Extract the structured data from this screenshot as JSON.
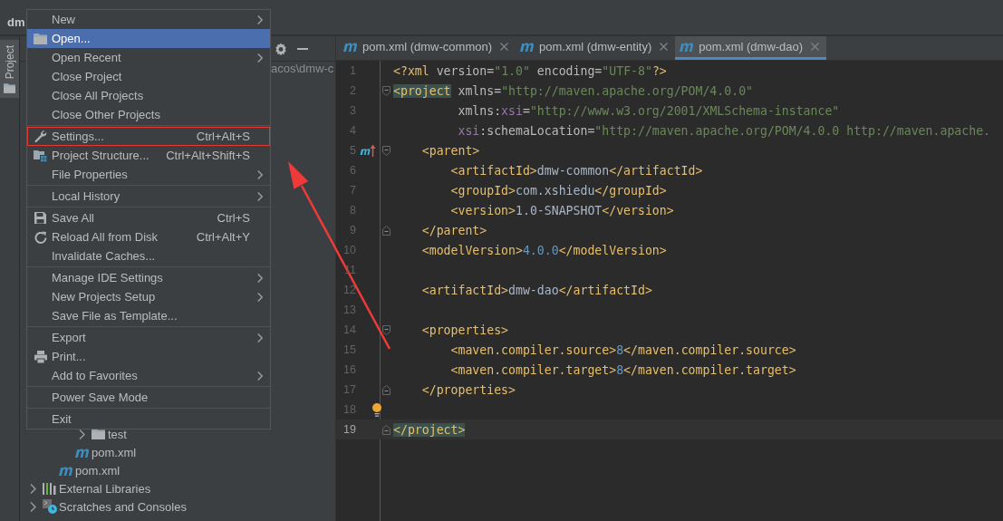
{
  "navbar": {
    "project_label": "dm"
  },
  "tool_window_strip": [
    {
      "label": "Project",
      "selected": true
    }
  ],
  "project_panel": {
    "path_fragment": "acos\\dmw-c",
    "tree": [
      {
        "children": [
          {
            "children": [
              {
                "children": [
                  {
                    "label": "test",
                    "kind": "folder",
                    "expanded": false
                  }
                ]
              },
              {
                "label": "pom.xml",
                "kind": "maven"
              }
            ]
          },
          {
            "label": "pom.xml",
            "kind": "maven"
          }
        ]
      },
      {
        "label": "External Libraries",
        "kind": "libraries",
        "expanded": false
      },
      {
        "label": "Scratches and Consoles",
        "kind": "scratches",
        "expanded": false
      }
    ]
  },
  "file_menu": {
    "groups": [
      [
        {
          "label": "New",
          "submenu": true,
          "selected": false
        },
        {
          "label": "Open...",
          "kind": "folder",
          "submenu": false,
          "selected": true
        },
        {
          "label": "Open Recent",
          "submenu": true,
          "selected": false
        },
        {
          "label": "Close Project",
          "submenu": false,
          "selected": false
        },
        {
          "label": "Close All Projects",
          "submenu": false,
          "selected": false
        },
        {
          "label": "Close Other Projects",
          "submenu": false,
          "selected": false
        }
      ],
      [
        {
          "label": "Settings...",
          "kind": "wrench",
          "shortcut": "Ctrl+Alt+S",
          "submenu": false,
          "selected": false,
          "boxed": true
        },
        {
          "label": "Project Structure...",
          "kind": "structure",
          "shortcut": "Ctrl+Alt+Shift+S",
          "submenu": false,
          "selected": false
        },
        {
          "label": "File Properties",
          "submenu": true,
          "selected": false
        }
      ],
      [
        {
          "label": "Local History",
          "submenu": true,
          "selected": false
        }
      ],
      [
        {
          "label": "Save All",
          "kind": "save",
          "shortcut": "Ctrl+S",
          "submenu": false,
          "selected": false
        },
        {
          "label": "Reload All from Disk",
          "kind": "reload",
          "shortcut": "Ctrl+Alt+Y",
          "submenu": false,
          "selected": false
        },
        {
          "label": "Invalidate Caches...",
          "submenu": false,
          "selected": false
        }
      ],
      [
        {
          "label": "Manage IDE Settings",
          "submenu": true,
          "selected": false
        },
        {
          "label": "New Projects Setup",
          "submenu": true,
          "selected": false
        },
        {
          "label": "Save File as Template...",
          "submenu": false,
          "selected": false
        }
      ],
      [
        {
          "label": "Export",
          "submenu": true,
          "selected": false
        },
        {
          "label": "Print...",
          "kind": "printer",
          "submenu": false,
          "selected": false
        },
        {
          "label": "Add to Favorites",
          "submenu": true,
          "selected": false
        }
      ],
      [
        {
          "label": "Power Save Mode",
          "submenu": false,
          "selected": false
        }
      ],
      [
        {
          "label": "Exit",
          "submenu": false,
          "selected": false
        }
      ]
    ]
  },
  "editor_tabs": [
    {
      "label": "pom.xml (dmw-common)",
      "selected": false
    },
    {
      "label": "pom.xml (dmw-entity)",
      "selected": false
    },
    {
      "label": "pom.xml (dmw-dao)",
      "selected": true
    }
  ],
  "code_lines": [
    {
      "number": "1",
      "current": false,
      "tokens": [
        {
          "kind": "tag",
          "text": "<?xml"
        },
        {
          "kind": "attr",
          "text": " version="
        },
        {
          "kind": "value",
          "text": "\"1.0\""
        },
        {
          "kind": "attr",
          "text": " encoding="
        },
        {
          "kind": "value",
          "text": "\"UTF-8\""
        },
        {
          "kind": "tag",
          "text": "?>"
        }
      ]
    },
    {
      "number": "2",
      "current": false,
      "fold_start": true,
      "tokens": [
        {
          "kind": "tag",
          "text": "<project",
          "matched": true
        },
        {
          "kind": "attr",
          "text": " xmlns="
        },
        {
          "kind": "value",
          "text": "\"http://maven.apache.org/POM/4.0.0\""
        }
      ]
    },
    {
      "number": "3",
      "current": false,
      "tokens": [
        {
          "kind": "attr",
          "text": "         xmlns:"
        },
        {
          "kind": "ns",
          "text": "xsi"
        },
        {
          "kind": "attr",
          "text": "="
        },
        {
          "kind": "value",
          "text": "\"http://www.w3.org/2001/XMLSchema-instance\""
        }
      ]
    },
    {
      "number": "4",
      "current": false,
      "tokens": [
        {
          "kind": "ns",
          "text": "         xsi"
        },
        {
          "kind": "attr",
          "text": ":schemaLocation="
        },
        {
          "kind": "value",
          "text": "\"http://maven.apache.org/POM/4.0.0 http://maven.apache."
        }
      ]
    },
    {
      "number": "5",
      "current": false,
      "overrides_parent": true,
      "fold_start": true,
      "tokens": [
        {
          "kind": "tag",
          "text": "    <parent>"
        }
      ]
    },
    {
      "number": "6",
      "current": false,
      "tokens": [
        {
          "kind": "tag",
          "text": "        <artifactId>"
        },
        {
          "kind": "text",
          "text": "dmw-common"
        },
        {
          "kind": "tag",
          "text": "</artifactId>"
        }
      ]
    },
    {
      "number": "7",
      "current": false,
      "tokens": [
        {
          "kind": "tag",
          "text": "        <groupId>"
        },
        {
          "kind": "text",
          "text": "com.xshiedu"
        },
        {
          "kind": "tag",
          "text": "</groupId>"
        }
      ]
    },
    {
      "number": "8",
      "current": false,
      "tokens": [
        {
          "kind": "tag",
          "text": "        <version>"
        },
        {
          "kind": "text",
          "text": "1.0-SNAPSHOT"
        },
        {
          "kind": "tag",
          "text": "</version>"
        }
      ]
    },
    {
      "number": "9",
      "current": false,
      "fold_end": true,
      "tokens": [
        {
          "kind": "tag",
          "text": "    </parent>"
        }
      ]
    },
    {
      "number": "10",
      "current": false,
      "tokens": [
        {
          "kind": "tag",
          "text": "    <modelVersion>"
        },
        {
          "kind": "number",
          "text": "4.0.0"
        },
        {
          "kind": "tag",
          "text": "</modelVersion>"
        }
      ]
    },
    {
      "number": "11",
      "current": false
    },
    {
      "number": "12",
      "current": false,
      "tokens": [
        {
          "kind": "tag",
          "text": "    <artifactId>"
        },
        {
          "kind": "text",
          "text": "dmw-dao"
        },
        {
          "kind": "tag",
          "text": "</artifactId>"
        }
      ]
    },
    {
      "number": "13",
      "current": false
    },
    {
      "number": "14",
      "current": false,
      "fold_start": true,
      "tokens": [
        {
          "kind": "tag",
          "text": "    <properties>"
        }
      ]
    },
    {
      "number": "15",
      "current": false,
      "tokens": [
        {
          "kind": "tag",
          "text": "        <maven.compiler.source>"
        },
        {
          "kind": "number",
          "text": "8"
        },
        {
          "kind": "tag",
          "text": "</maven.compiler.source>"
        }
      ]
    },
    {
      "number": "16",
      "current": false,
      "tokens": [
        {
          "kind": "tag",
          "text": "        <maven.compiler.target>"
        },
        {
          "kind": "number",
          "text": "8"
        },
        {
          "kind": "tag",
          "text": "</maven.compiler.target>"
        }
      ]
    },
    {
      "number": "17",
      "current": false,
      "fold_end": true,
      "tokens": [
        {
          "kind": "tag",
          "text": "    </properties>"
        }
      ]
    },
    {
      "number": "18",
      "current": false,
      "intention_bulb": true
    },
    {
      "number": "19",
      "current": true,
      "fold_end": true,
      "tokens": [
        {
          "kind": "tag",
          "text": "</project>",
          "matched": true
        }
      ]
    }
  ],
  "annotation_arrow": true
}
